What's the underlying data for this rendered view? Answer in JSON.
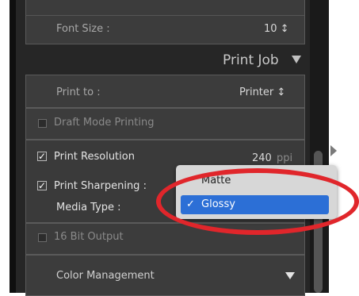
{
  "font_size": {
    "label": "Font Size :",
    "value": "10 ↕"
  },
  "print_job": {
    "title": "Print Job",
    "toggle_icon": "triangle-down-icon"
  },
  "print_to": {
    "label": "Print to :",
    "value": "Printer ↕"
  },
  "draft_mode": {
    "label": "Draft Mode Printing",
    "checked": false
  },
  "print_resolution": {
    "label": "Print Resolution",
    "checked": true,
    "value": "240",
    "unit": "ppi"
  },
  "print_sharpening": {
    "label": "Print Sharpening :",
    "checked": true
  },
  "media_type": {
    "label": "Media Type :"
  },
  "popup": {
    "options": [
      "Matte",
      "Glossy"
    ],
    "selected": "Glossy",
    "check": "✓"
  },
  "bit_output": {
    "label": "16 Bit Output",
    "checked": false
  },
  "color_management": {
    "label": "Color Management",
    "toggle_icon": "triangle-down-icon"
  },
  "colors": {
    "selection": "#2c6fd6",
    "annotation": "#e0262b"
  }
}
